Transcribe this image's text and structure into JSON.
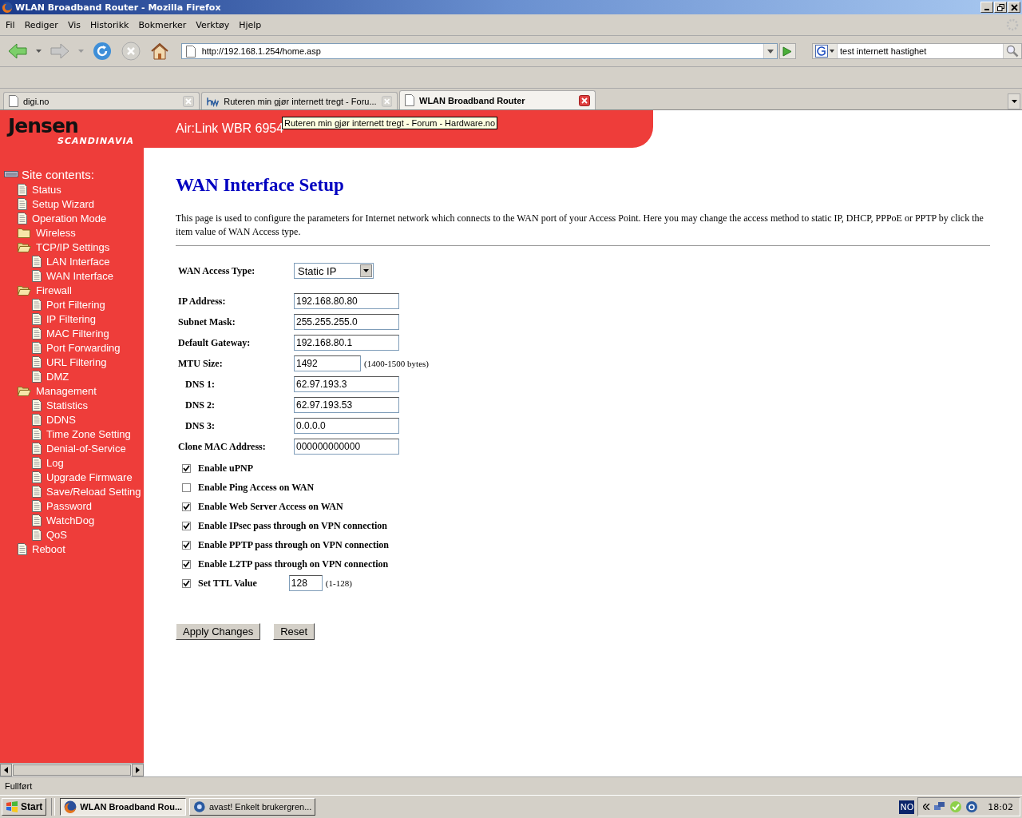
{
  "window": {
    "title": "WLAN Broadband Router - Mozilla Firefox"
  },
  "menu": [
    "Fil",
    "Rediger",
    "Vis",
    "Historikk",
    "Bokmerker",
    "Verktøy",
    "Hjelp"
  ],
  "address_bar": {
    "value": "http://192.168.1.254/home.asp"
  },
  "search": {
    "value": "test internett hastighet"
  },
  "tabs": [
    {
      "label": "digi.no",
      "selected": false
    },
    {
      "label": "Ruteren min gjør internett tregt - Foru...",
      "selected": false
    },
    {
      "label": "WLAN Broadband Router",
      "selected": true
    }
  ],
  "tooltip": "Ruteren min gjør internett tregt - Forum - Hardware.no",
  "header": {
    "logo": "Jensen",
    "logo_sub": "SCANDINAVIA",
    "model": "Air:Link WBR 6954"
  },
  "sidebar": {
    "heading": "Site contents:",
    "items": [
      {
        "label": "Status",
        "kind": "page"
      },
      {
        "label": "Setup Wizard",
        "kind": "page"
      },
      {
        "label": "Operation Mode",
        "kind": "page"
      },
      {
        "label": "Wireless",
        "kind": "folder",
        "expanded": false
      },
      {
        "label": "TCP/IP Settings",
        "kind": "folder",
        "expanded": true,
        "children": [
          {
            "label": "LAN Interface",
            "kind": "page"
          },
          {
            "label": "WAN Interface",
            "kind": "page"
          }
        ]
      },
      {
        "label": "Firewall",
        "kind": "folder",
        "expanded": true,
        "children": [
          {
            "label": "Port Filtering",
            "kind": "page"
          },
          {
            "label": "IP Filtering",
            "kind": "page"
          },
          {
            "label": "MAC Filtering",
            "kind": "page"
          },
          {
            "label": "Port Forwarding",
            "kind": "page"
          },
          {
            "label": "URL Filtering",
            "kind": "page"
          },
          {
            "label": "DMZ",
            "kind": "page"
          }
        ]
      },
      {
        "label": "Management",
        "kind": "folder",
        "expanded": true,
        "children": [
          {
            "label": "Statistics",
            "kind": "page"
          },
          {
            "label": "DDNS",
            "kind": "page"
          },
          {
            "label": "Time Zone Setting",
            "kind": "page"
          },
          {
            "label": "Denial-of-Service",
            "kind": "page"
          },
          {
            "label": "Log",
            "kind": "page"
          },
          {
            "label": "Upgrade Firmware",
            "kind": "page"
          },
          {
            "label": "Save/Reload Setting",
            "kind": "page"
          },
          {
            "label": "Password",
            "kind": "page"
          },
          {
            "label": "WatchDog",
            "kind": "page"
          },
          {
            "label": "QoS",
            "kind": "page"
          }
        ]
      },
      {
        "label": "Reboot",
        "kind": "page"
      }
    ]
  },
  "page": {
    "title": "WAN Interface Setup",
    "description": "This page is used to configure the parameters for Internet network which connects to the WAN port of your Access Point. Here you may change the access method to static IP, DHCP, PPPoE or PPTP by click the item value of WAN Access type.",
    "access_type": {
      "label": "WAN Access Type:",
      "value": "Static IP"
    },
    "fields": [
      {
        "label": "IP Address:",
        "value": "192.168.80.80",
        "kind": "main"
      },
      {
        "label": "Subnet Mask:",
        "value": "255.255.255.0",
        "kind": "main"
      },
      {
        "label": "Default Gateway:",
        "value": "192.168.80.1",
        "kind": "main"
      },
      {
        "label": "MTU Size:",
        "value": "1492",
        "kind": "short",
        "note": "(1400-1500 bytes)"
      },
      {
        "label": "DNS 1:",
        "value": "62.97.193.3",
        "kind": "indented"
      },
      {
        "label": "DNS 2:",
        "value": "62.97.193.53",
        "kind": "indented"
      },
      {
        "label": "DNS 3:",
        "value": "0.0.0.0",
        "kind": "indented"
      },
      {
        "label": "Clone MAC Address:",
        "value": "000000000000",
        "kind": "main"
      }
    ],
    "options": [
      {
        "label": "Enable uPNP",
        "checked": true
      },
      {
        "label": "Enable Ping Access on WAN",
        "checked": false
      },
      {
        "label": "Enable Web Server Access on WAN",
        "checked": true
      },
      {
        "label": "Enable IPsec pass through on VPN connection",
        "checked": true
      },
      {
        "label": "Enable PPTP pass through on VPN connection",
        "checked": true
      },
      {
        "label": "Enable L2TP pass through on VPN connection",
        "checked": true
      },
      {
        "label": "Set TTL Value",
        "checked": true,
        "value": "128",
        "note": "(1-128)"
      }
    ],
    "buttons": [
      "Apply Changes",
      "Reset"
    ]
  },
  "status_bar": "Fullført",
  "taskbar": {
    "start": "Start",
    "tasks": [
      {
        "label": "WLAN Broadband Rou...",
        "selected": true
      },
      {
        "label": "avast! Enkelt brukergren...",
        "selected": false
      }
    ],
    "language": "NO",
    "clock": "18:02"
  }
}
